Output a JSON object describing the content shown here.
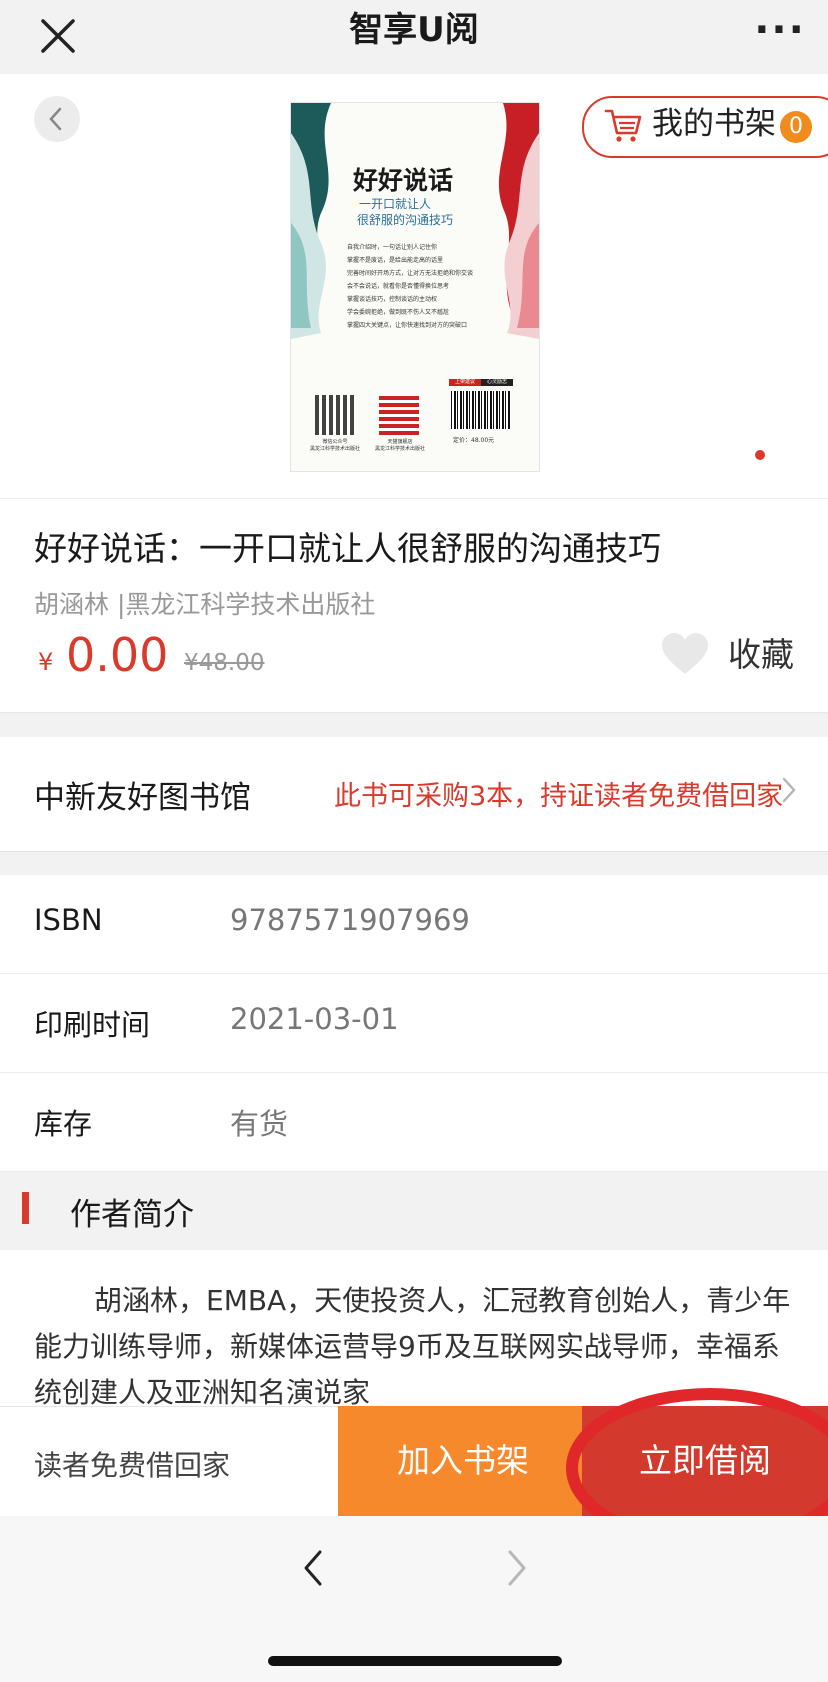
{
  "header": {
    "title": "智享U阅",
    "more": "···"
  },
  "cover": {
    "title": "好好说话",
    "subtitle_1": "一开口就让人",
    "subtitle_2": "很舒服的沟通技巧",
    "bullets": [
      "自我介绍时，一句话让别人记住你",
      "掌握不是废话，是给出能走高的话里",
      "完善时间好开场方式，让对方无法拒绝和你交谈",
      "会不会说话，就看你是否懂得换位思考",
      "掌握谈话技巧，控制谈话的主动权",
      "学会委婉拒绝，做到既不伤人又不尴尬",
      "掌握四大关键点，让你快速找到对方的突破口"
    ],
    "qr1_caption_1": "微信公众号",
    "qr1_caption_2": "黑龙江科学技术出版社",
    "qr2_caption_1": "天猫旗舰店",
    "qr2_caption_2": "黑龙江科学技术出版社",
    "barcode_tags": [
      "上架建议",
      "心灵励志"
    ],
    "price_label": "定价：48.00元"
  },
  "shelf": {
    "label": "我的书架",
    "count": "0"
  },
  "book": {
    "title": "好好说话：一开口就让人很舒服的沟通技巧",
    "meta": "胡涵林 |黑龙江科学技术出版社",
    "price_symbol": "¥",
    "price": "0.00",
    "original_price": "¥48.00",
    "favorite_label": "收藏"
  },
  "library": {
    "name": "中新友好图书馆",
    "note": "此书可采购3本，持证读者免费借回家"
  },
  "details": [
    {
      "label": "ISBN",
      "value": "9787571907969"
    },
    {
      "label": "印刷时间",
      "value": "2021-03-01"
    },
    {
      "label": "库存",
      "value": "有货"
    }
  ],
  "author": {
    "heading": "作者简介",
    "text": "胡涵林，EMBA，天使投资人，汇冠教育创始人，青少年能力训练导师，新媒体运营导9币及互联网实战导师，幸福系统创建人及亚洲知名演说家"
  },
  "actions": {
    "note": "读者免费借回家",
    "add_to_shelf": "加入书架",
    "borrow_now": "立即借阅"
  },
  "colors": {
    "accent_red": "#d93a2c",
    "orange": "#f5892b",
    "borrow_red": "#d3392c"
  }
}
